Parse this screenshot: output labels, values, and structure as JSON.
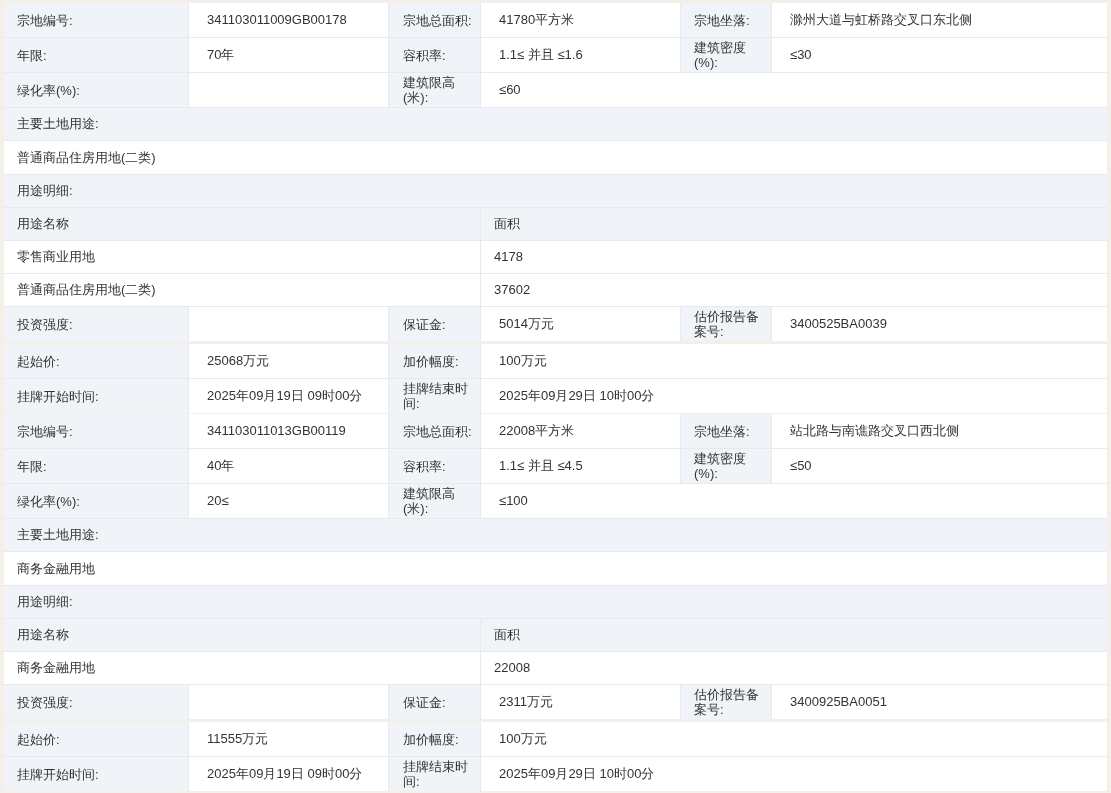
{
  "parcels": [
    {
      "rows": [
        {
          "kind": "pairs",
          "cells": [
            {
              "label": "宗地编号:",
              "value": "341103011009GB00178"
            },
            {
              "label": "宗地总面积:",
              "value": "41780平方米"
            },
            {
              "label": "宗地坐落:",
              "value": "滁州大道与虹桥路交叉口东北侧"
            }
          ]
        },
        {
          "kind": "pairs",
          "cells": [
            {
              "label": "年限:",
              "value": "70年"
            },
            {
              "label": "容积率:",
              "value": "1.1≤ 并且 ≤1.6"
            },
            {
              "label": "建筑密度(%):",
              "value": "≤30"
            }
          ]
        },
        {
          "kind": "pairs",
          "cells": [
            {
              "label": "绿化率(%):"
            },
            {
              "label": "建筑限高(米):",
              "value": "≤60"
            }
          ]
        },
        {
          "kind": "heading",
          "text": "主要土地用途:"
        },
        {
          "kind": "line",
          "text": "普通商品住房用地(二类)"
        },
        {
          "kind": "heading",
          "text": "用途明细:"
        },
        {
          "kind": "column_header",
          "cells": [
            "用途名称",
            "面积"
          ]
        },
        {
          "kind": "column_row",
          "cells": [
            "零售商业用地",
            "4178"
          ]
        },
        {
          "kind": "column_row",
          "cells": [
            "普通商品住房用地(二类)",
            "37602"
          ]
        },
        {
          "kind": "pairs",
          "cells": [
            {
              "label": "投资强度:"
            },
            {
              "label": "保证金:",
              "value": "5014万元"
            },
            {
              "label": "估价报告备案号:",
              "value": "3400525BA0039"
            }
          ]
        }
      ],
      "listing": [
        {
          "kind": "pairs",
          "cells": [
            {
              "label": "起始价:",
              "value": "25068万元"
            },
            {
              "label": "加价幅度:",
              "value": "100万元"
            }
          ]
        },
        {
          "kind": "pairs",
          "cells": [
            {
              "label": "挂牌开始时间:",
              "value": "2025年09月19日 09时00分"
            },
            {
              "label": "挂牌结束时间:",
              "value": "2025年09月29日 10时00分"
            }
          ]
        }
      ]
    },
    {
      "rows": [
        {
          "kind": "pairs",
          "cells": [
            {
              "label": "宗地编号:",
              "value": "341103011013GB00119"
            },
            {
              "label": "宗地总面积:",
              "value": "22008平方米"
            },
            {
              "label": "宗地坐落:",
              "value": "站北路与南谯路交叉口西北侧"
            }
          ]
        },
        {
          "kind": "pairs",
          "cells": [
            {
              "label": "年限:",
              "value": "40年"
            },
            {
              "label": "容积率:",
              "value": "1.1≤ 并且 ≤4.5"
            },
            {
              "label": "建筑密度(%):",
              "value": "≤50"
            }
          ]
        },
        {
          "kind": "pairs",
          "cells": [
            {
              "label": "绿化率(%):",
              "value": "20≤"
            },
            {
              "label": "建筑限高(米):",
              "value": "≤100"
            }
          ]
        },
        {
          "kind": "heading",
          "text": "主要土地用途:"
        },
        {
          "kind": "line",
          "text": "商务金融用地"
        },
        {
          "kind": "heading",
          "text": "用途明细:"
        },
        {
          "kind": "column_header",
          "cells": [
            "用途名称",
            "面积"
          ]
        },
        {
          "kind": "column_row",
          "cells": [
            "商务金融用地",
            "22008"
          ]
        },
        {
          "kind": "pairs",
          "cells": [
            {
              "label": "投资强度:"
            },
            {
              "label": "保证金:",
              "value": "2311万元"
            },
            {
              "label": "估价报告备案号:",
              "value": "3400925BA0051"
            }
          ]
        }
      ],
      "listing": [
        {
          "kind": "pairs",
          "cells": [
            {
              "label": "起始价:",
              "value": "11555万元"
            },
            {
              "label": "加价幅度:",
              "value": "100万元"
            }
          ]
        },
        {
          "kind": "pairs",
          "cells": [
            {
              "label": "挂牌开始时间:",
              "value": "2025年09月19日 09时00分"
            },
            {
              "label": "挂牌结束时间:",
              "value": "2025年09月29日 10时00分"
            }
          ]
        }
      ]
    }
  ]
}
